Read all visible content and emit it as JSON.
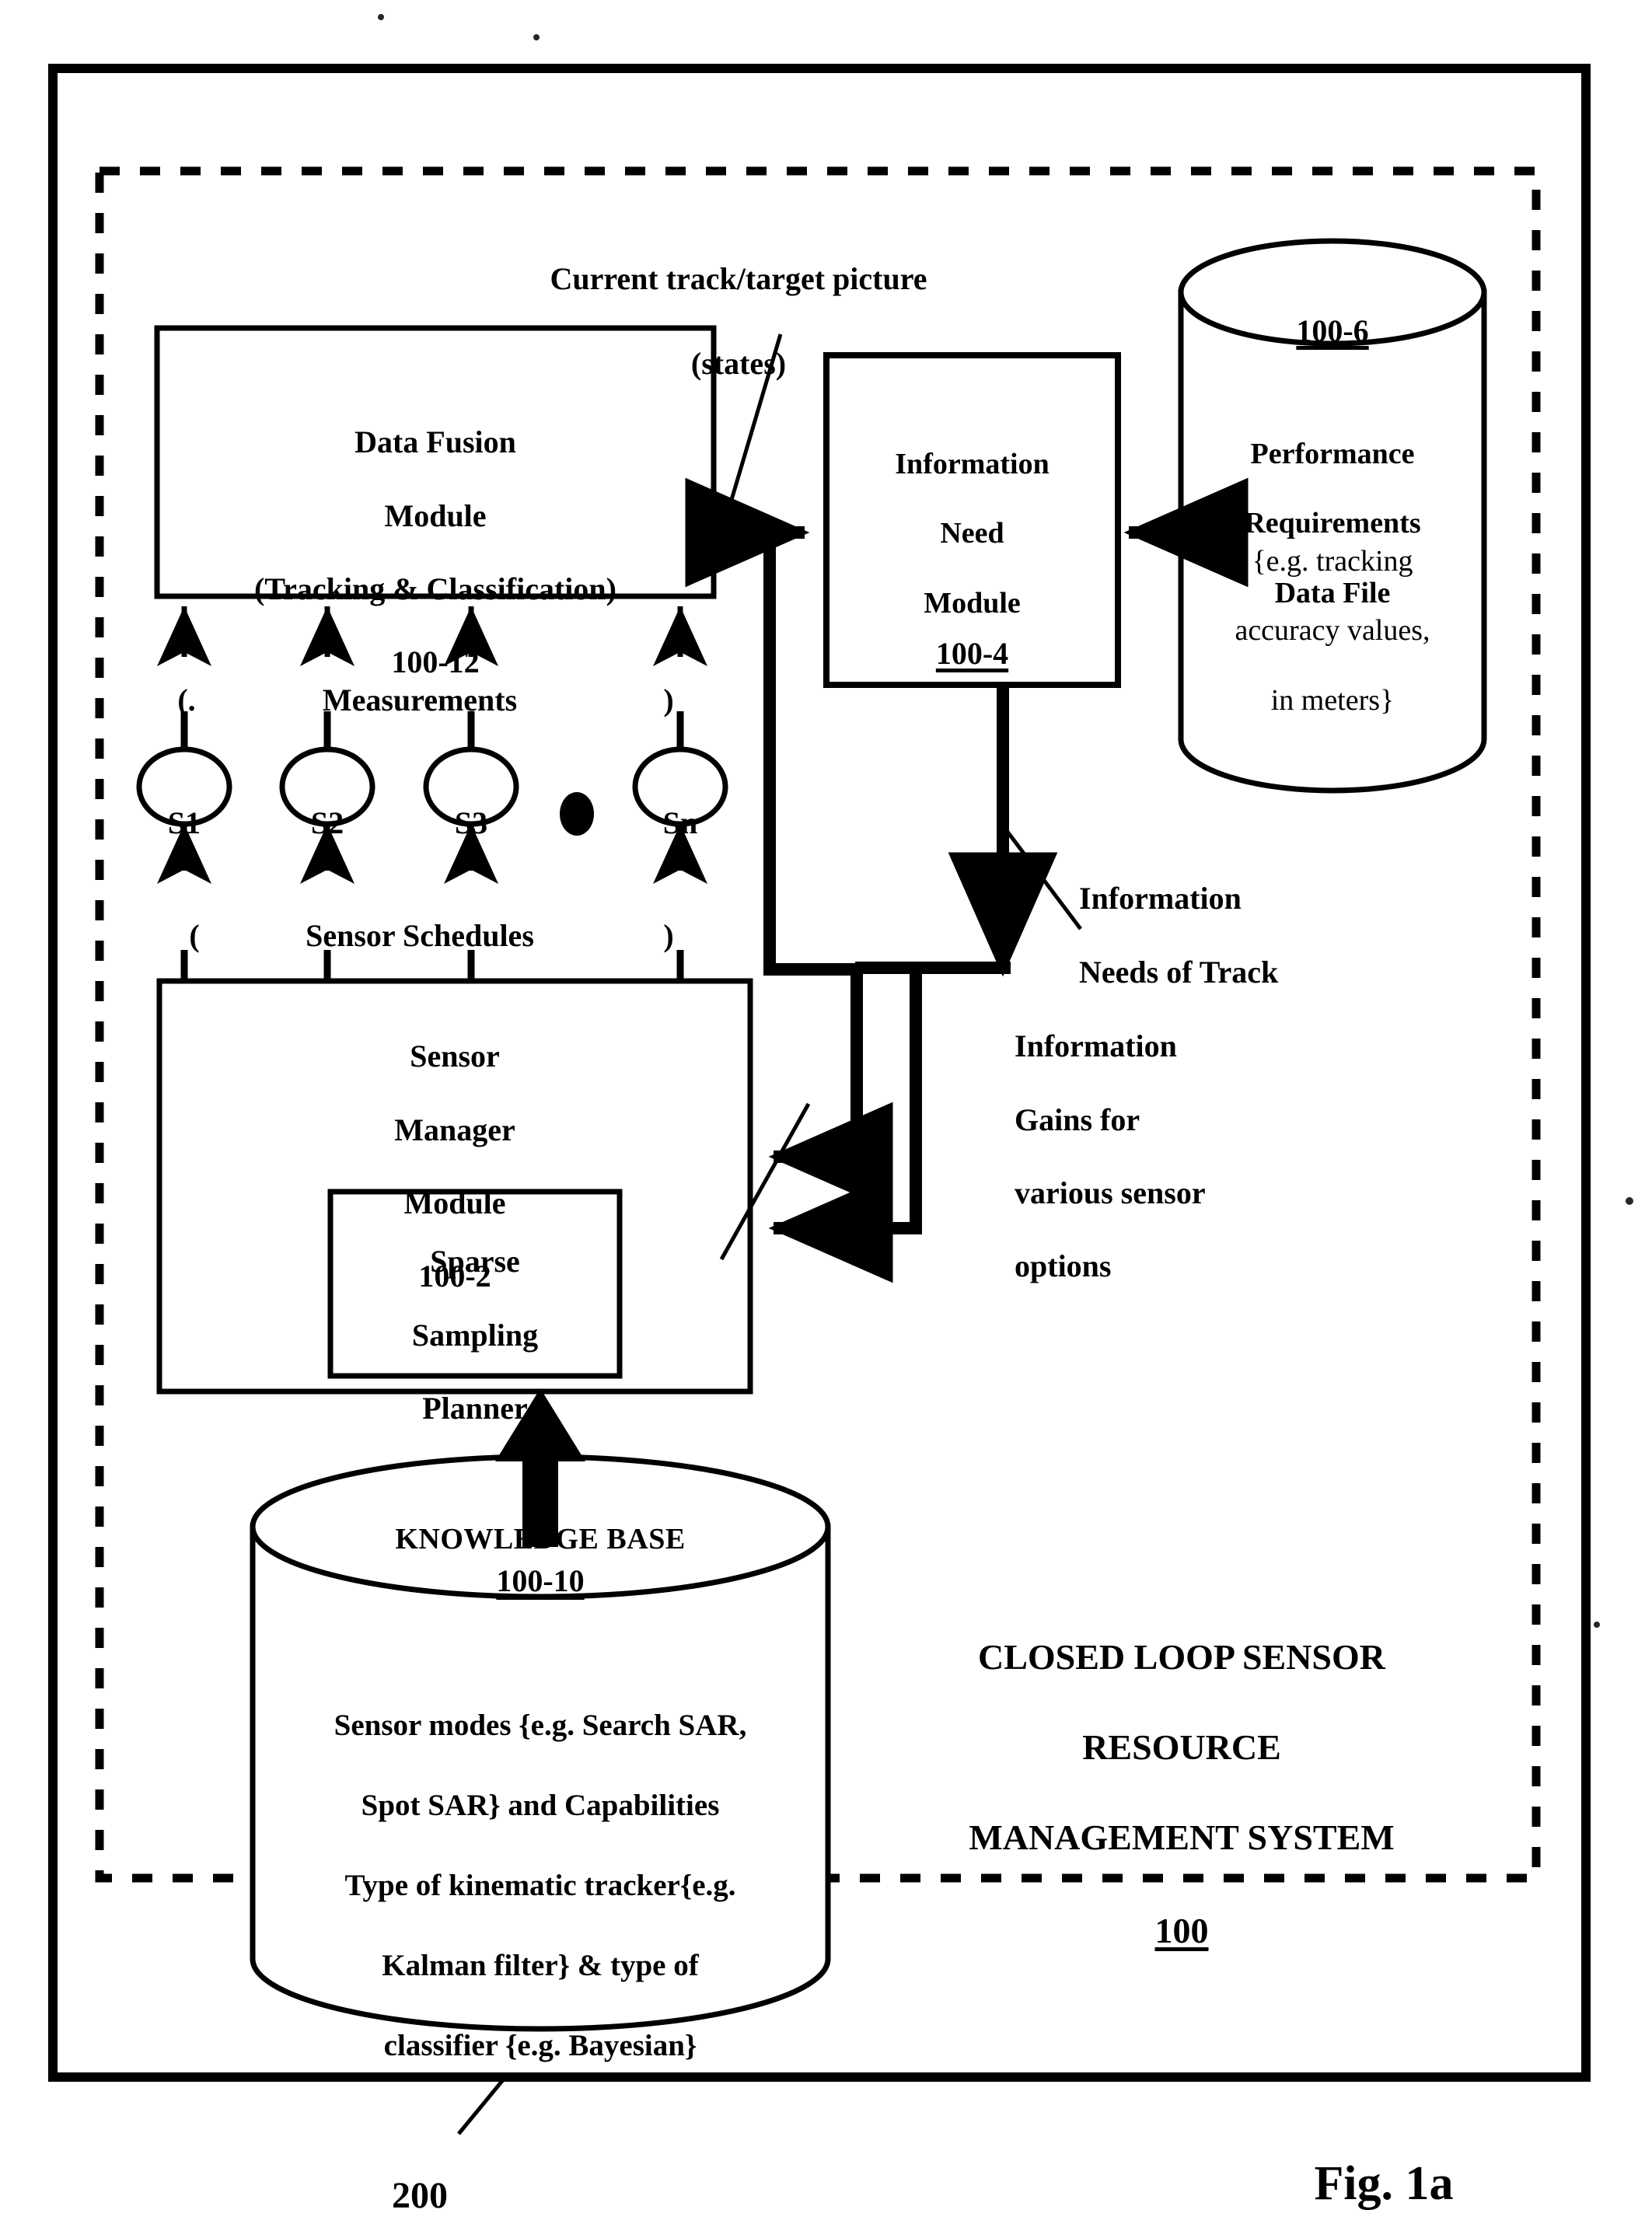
{
  "figure": {
    "fig_label": "Fig. 1a",
    "outer_ref": "200",
    "system_title_line1": "CLOSED LOOP SENSOR",
    "system_title_line2": "RESOURCE",
    "system_title_line3": "MANAGEMENT SYSTEM",
    "system_ref": "100"
  },
  "blocks": {
    "data_fusion": {
      "line1": "Data Fusion",
      "line2": "Module",
      "line3": "(Tracking & Classification)",
      "ref": "100-12"
    },
    "information_need": {
      "line1": "Information",
      "line2": "Need",
      "line3": "Module",
      "ref": "100-4"
    },
    "performance_requirements": {
      "ref": "100-6",
      "title_line1": "Performance",
      "title_line2": "Requirements",
      "title_line3": "Data File",
      "note_line1": "{e.g. tracking",
      "note_line2": "accuracy values,",
      "note_line3": "in meters}"
    },
    "sensor_manager": {
      "line1": "Sensor",
      "line2": "Manager",
      "line3": "Module",
      "ref": "100-2"
    },
    "sparse_sampling_planner": {
      "line1": "Sparse",
      "line2": "Sampling",
      "line3": "Planner"
    },
    "knowledge_base": {
      "title": "KNOWLEDGE BASE",
      "ref": "100-10",
      "body_line1": "Sensor modes {e.g. Search SAR,",
      "body_line2": "Spot SAR} and Capabilities",
      "body_line3": "Type of kinematic tracker{e.g.",
      "body_line4": "Kalman filter} & type of",
      "body_line5": "classifier {e.g. Bayesian}"
    }
  },
  "sensors": [
    {
      "label": "S1"
    },
    {
      "label": "S2"
    },
    {
      "label": "S3"
    },
    {
      "label": "Sn"
    }
  ],
  "annotations": {
    "current_track_line1": "Current track/target picture",
    "current_track_line2": "(states)",
    "measurements_open": "(.",
    "measurements": "Measurements",
    "measurements_close": ")",
    "schedules_open": "(",
    "schedules": "Sensor Schedules",
    "schedules_close": ")",
    "info_needs_line1": "Information",
    "info_needs_line2": "Needs of Track",
    "info_gains_line1": "Information",
    "info_gains_line2": "Gains for",
    "info_gains_line3": "various sensor",
    "info_gains_line4": "options"
  }
}
